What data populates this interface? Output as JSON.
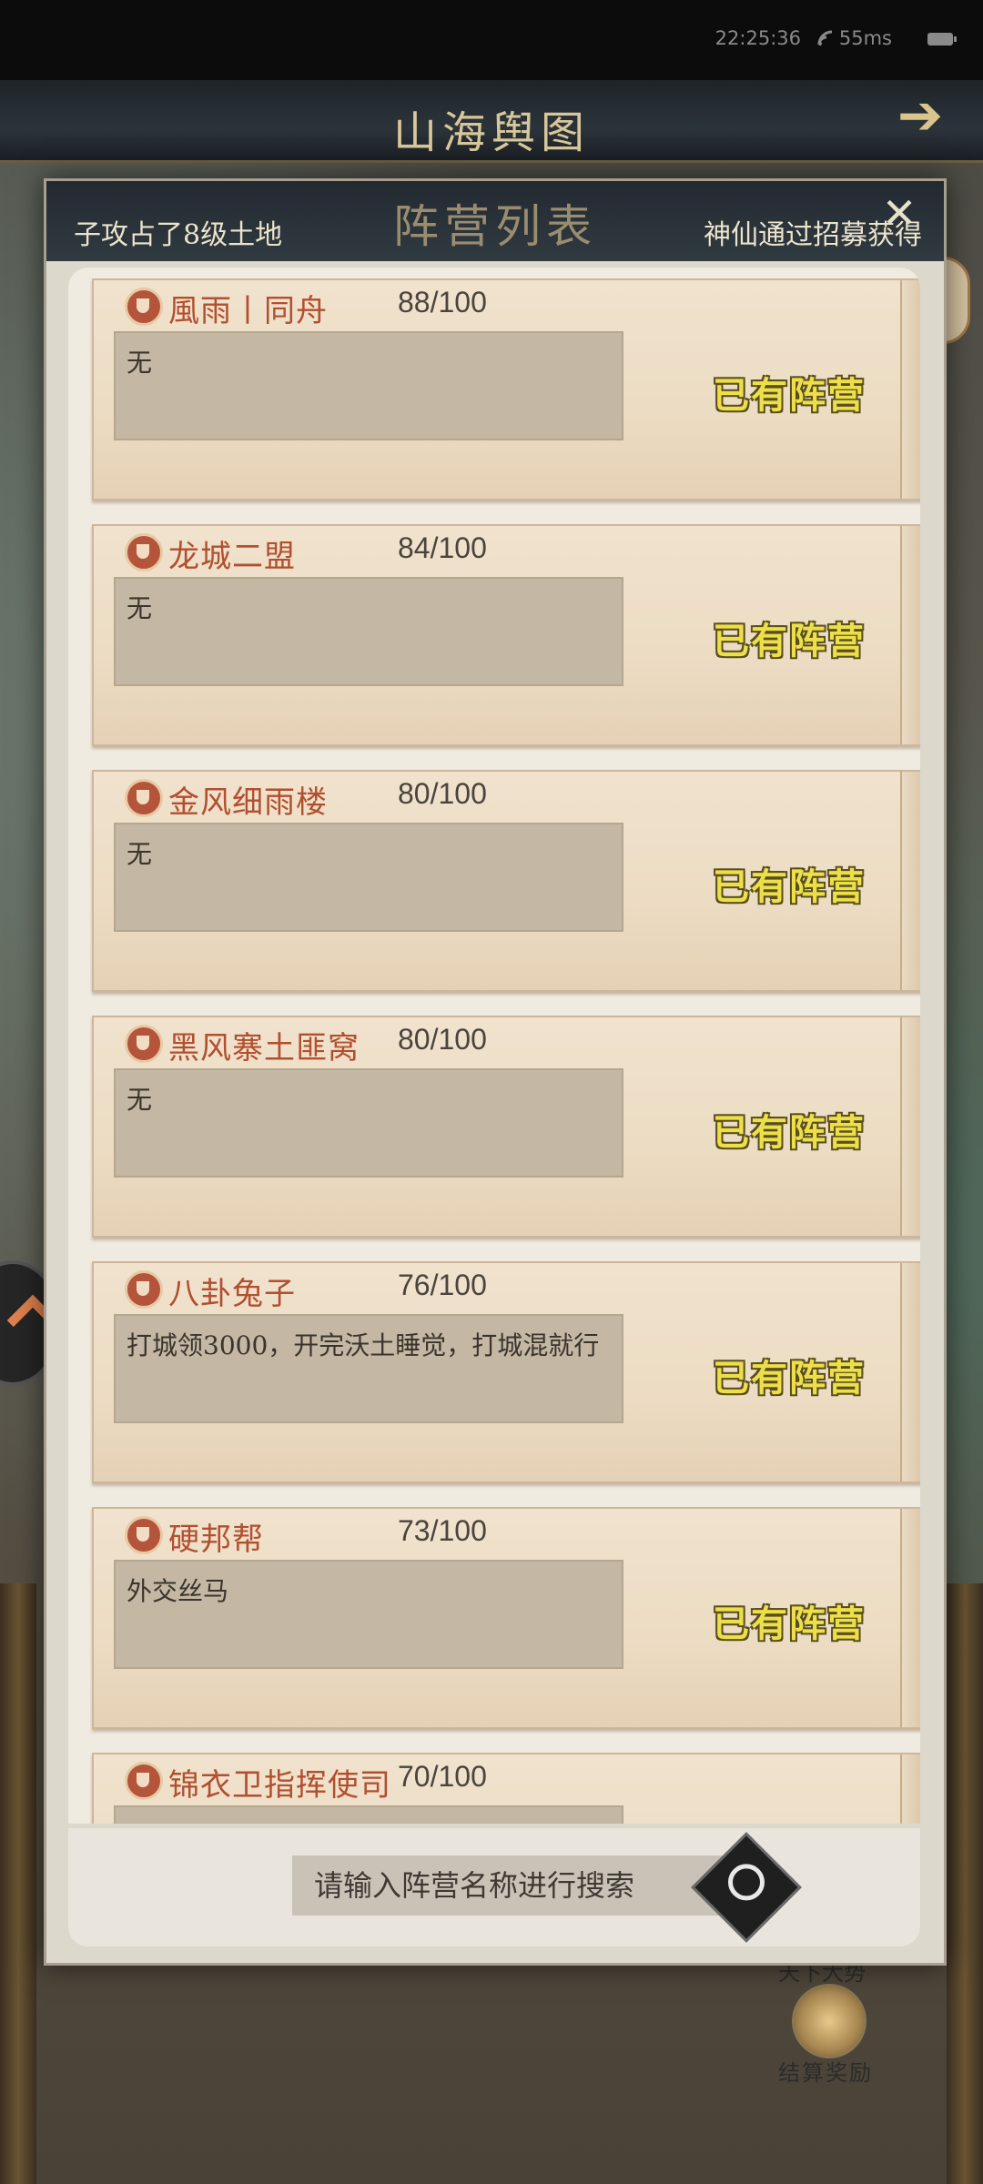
{
  "status_bar": {
    "time": "22:25:36",
    "ping": "55ms"
  },
  "game": {
    "title": "山海舆图",
    "reward_label": "结算奖励",
    "daily_label": "天下大势"
  },
  "dialog": {
    "title": "阵营列表",
    "ticker_left": "子攻占了8级土地",
    "ticker_right": "神仙通过招募获得",
    "search": {
      "placeholder": "请输入阵营名称进行搜索"
    },
    "camps": [
      {
        "name": "風雨丨同舟",
        "count": "88/100",
        "desc": "无",
        "status": "已有阵营"
      },
      {
        "name": "龙城二盟",
        "count": "84/100",
        "desc": "无",
        "status": "已有阵营"
      },
      {
        "name": "金风细雨楼",
        "count": "80/100",
        "desc": "无",
        "status": "已有阵营"
      },
      {
        "name": "黑风寨土匪窝",
        "count": "80/100",
        "desc": "无",
        "status": "已有阵营"
      },
      {
        "name": "八卦兔子",
        "count": "76/100",
        "desc": "打城领3000，开完沃土睡觉，打城混就行",
        "status": "已有阵营"
      },
      {
        "name": "硬邦帮",
        "count": "73/100",
        "desc": "外交丝马",
        "status": "已有阵营"
      },
      {
        "name": "锦衣卫指挥使司",
        "count": "70/100",
        "desc": "",
        "status": ""
      }
    ]
  }
}
